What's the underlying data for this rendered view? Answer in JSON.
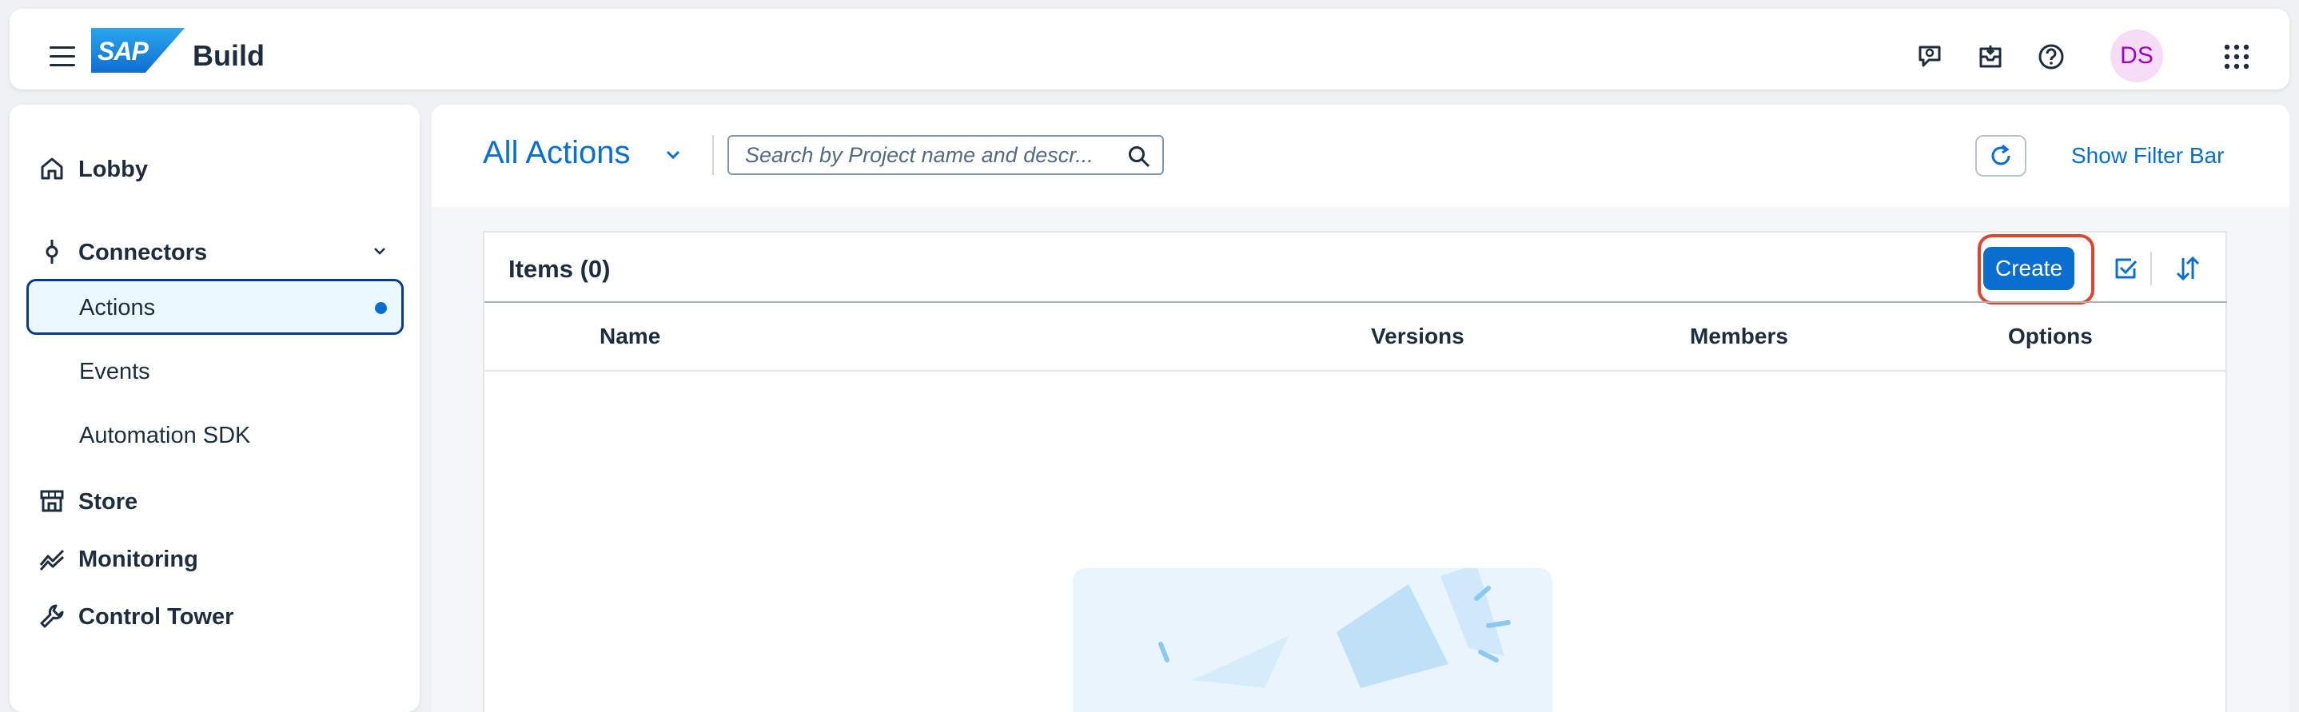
{
  "shellbar": {
    "logo_text": "SAP",
    "app_name": "Build",
    "icons": [
      "menu-icon",
      "feedback-icon",
      "inbox-icon",
      "help-icon",
      "product-switch-icon"
    ],
    "avatar_initials": "DS"
  },
  "sidebar": {
    "items": [
      {
        "label": "Lobby",
        "icon": "home-icon"
      },
      {
        "label": "Connectors",
        "icon": "connector-icon",
        "expanded": true,
        "children": [
          {
            "label": "Actions",
            "selected": true
          },
          {
            "label": "Events"
          },
          {
            "label": "Automation SDK"
          }
        ]
      },
      {
        "label": "Store",
        "icon": "store-icon"
      },
      {
        "label": "Monitoring",
        "icon": "monitoring-icon"
      },
      {
        "label": "Control Tower",
        "icon": "wrench-icon"
      }
    ]
  },
  "header": {
    "title": "All Actions",
    "search_placeholder": "Search by Project name and descr...",
    "filter_bar_label": "Show Filter Bar"
  },
  "table": {
    "title": "Items (0)",
    "create_label": "Create",
    "columns": [
      "Name",
      "Versions",
      "Members",
      "Options"
    ],
    "rows": []
  },
  "colors": {
    "accent": "#0a6ed1",
    "highlight": "#e0432e",
    "selected_bg": "#ebf8ff",
    "avatar_bg": "#f6dcf6",
    "avatar_text": "#a100c2"
  }
}
